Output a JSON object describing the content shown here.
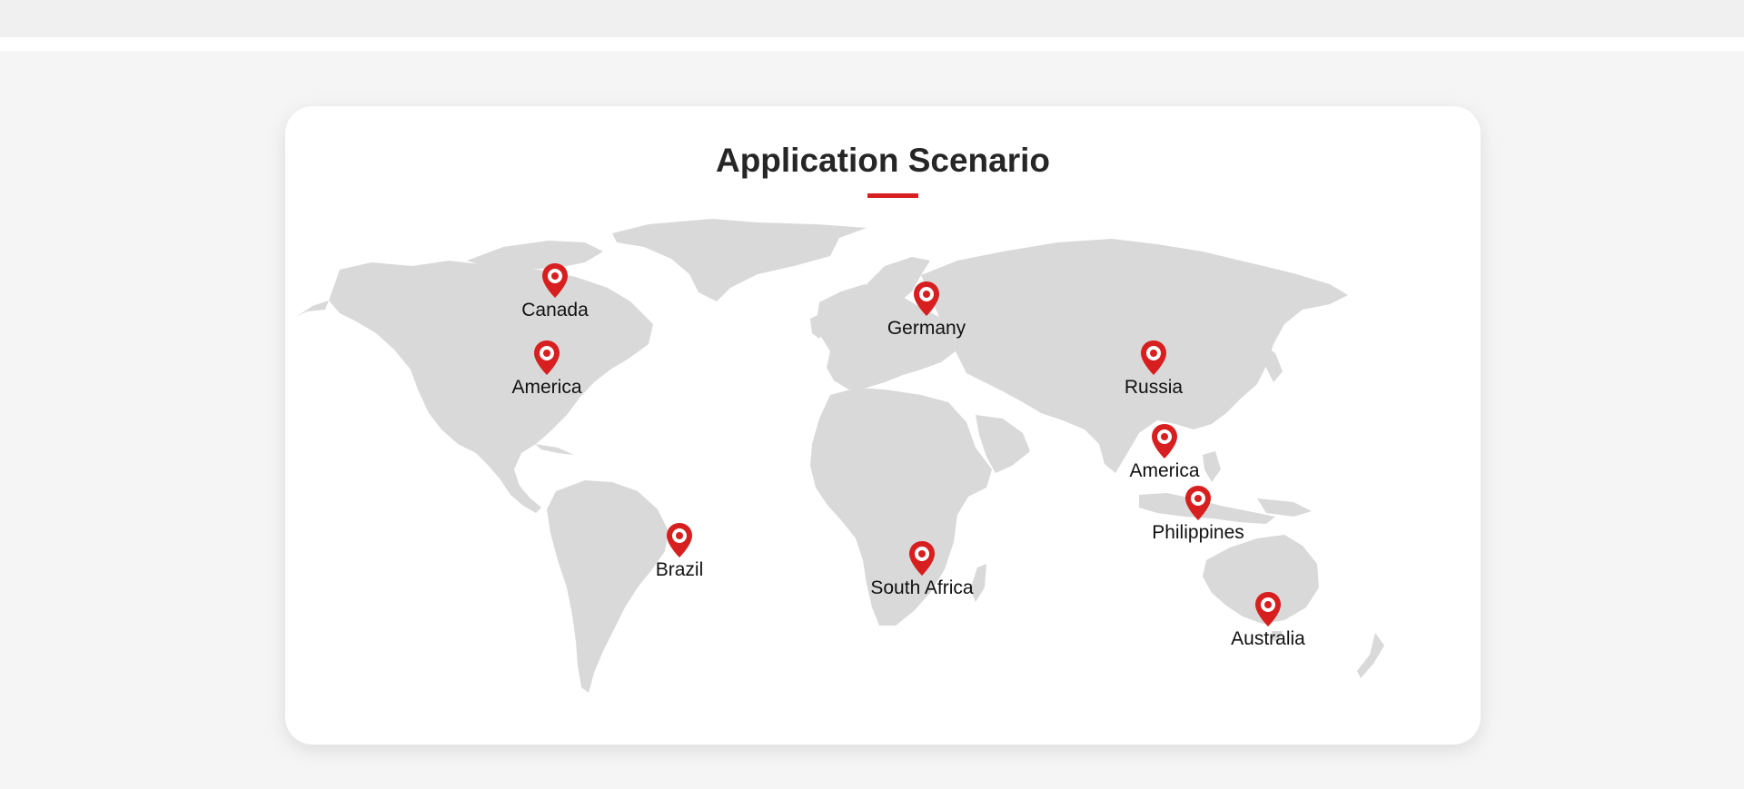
{
  "section": {
    "title": "Application Scenario"
  },
  "colors": {
    "accent": "#d71f1f",
    "map_land": "#d9d9d9",
    "card_background": "#ffffff",
    "page_background": "#f5f5f5"
  },
  "map": {
    "icon": "world-map",
    "marker_icon": "location-pin-icon",
    "locations": [
      {
        "label": "Canada"
      },
      {
        "label": "America"
      },
      {
        "label": "Germany"
      },
      {
        "label": "Russia"
      },
      {
        "label": "America"
      },
      {
        "label": "Philippines"
      },
      {
        "label": "Brazil"
      },
      {
        "label": "South Africa"
      },
      {
        "label": "Australia"
      }
    ]
  }
}
